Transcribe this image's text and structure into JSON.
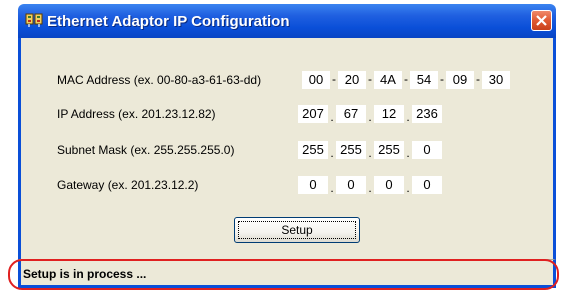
{
  "window": {
    "title": "Ethernet Adaptor IP Configuration",
    "title_icon": "network-adapter-icon",
    "close_icon": "close-icon",
    "titlebar_color": "#0a4fd8",
    "close_color": "#e05a32"
  },
  "form": {
    "mac": {
      "label": "MAC Address (ex. 00-80-a3-61-63-dd)",
      "octets": [
        "00",
        "20",
        "4A",
        "54",
        "09",
        "30"
      ],
      "separator": "-"
    },
    "ip": {
      "label": "IP Address (ex. 201.23.12.82)",
      "octets": [
        "207",
        "67",
        "12",
        "236"
      ],
      "separator": "."
    },
    "subnet": {
      "label": "Subnet Mask (ex. 255.255.255.0)",
      "octets": [
        "255",
        "255",
        "255",
        "0"
      ],
      "separator": "."
    },
    "gateway": {
      "label": "Gateway (ex. 201.23.12.2)",
      "octets": [
        "0",
        "0",
        "0",
        "0"
      ],
      "separator": "."
    },
    "setup_button": "Setup"
  },
  "status": {
    "text": "Setup is in process ...",
    "highlight_color": "#e02020"
  }
}
